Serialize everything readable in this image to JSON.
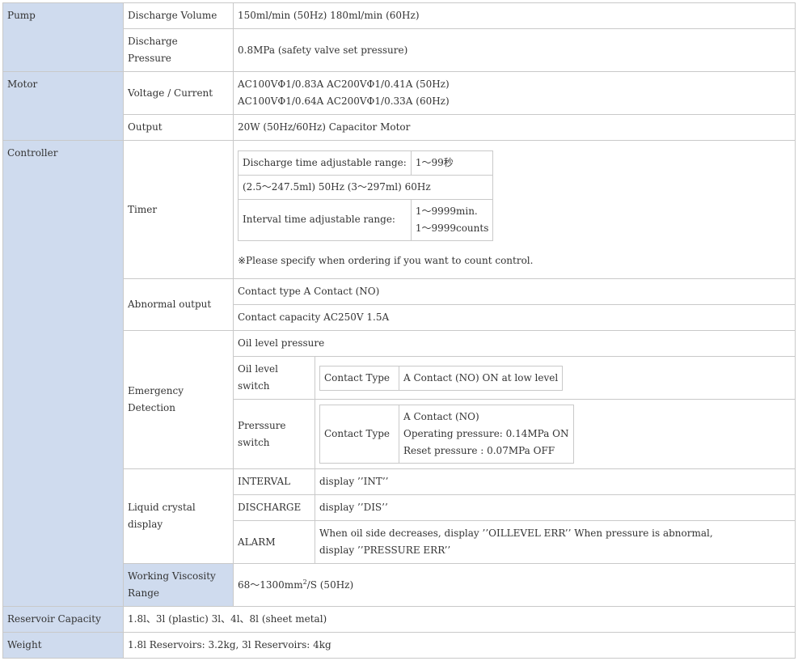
{
  "pump": {
    "heading": "Pump",
    "discharge_volume_label": "Discharge Volume",
    "discharge_volume_value": "150ml/min (50Hz)  180ml/min (60Hz)",
    "discharge_pressure_label": "Discharge\nPressure",
    "discharge_pressure_value": "0.8MPa (safety valve set pressure)"
  },
  "motor": {
    "heading": "Motor",
    "voltage_label": "Voltage / Current",
    "voltage_line1": "AC100VΦ1/0.83A  AC200VΦ1/0.41A (50Hz)",
    "voltage_line2": "AC100VΦ1/0.64A  AC200VΦ1/0.33A (60Hz)",
    "output_label": "Output",
    "output_value": "20W (50Hz/60Hz)  Capacitor Motor"
  },
  "controller": {
    "heading": "Controller",
    "timer_label": "Timer",
    "timer": {
      "discharge_time_label": "Discharge time adjustable range:",
      "discharge_time_value": "1〜99秒",
      "discharge_range_note": "(2.5〜247.5ml) 50Hz (3〜297ml) 60Hz",
      "interval_time_label": "Interval time adjustable range:",
      "interval_value_line1": "1〜9999min.",
      "interval_value_line2": "1〜9999counts",
      "count_note": "※Please specify when ordering if you want to count control."
    },
    "abnormal_output_label": "Abnormal output",
    "abnormal_contact_type": "Contact type A Contact (NO)",
    "abnormal_contact_capacity": "Contact capacity  AC250V  1.5A",
    "emergency_label": "Emergency\nDetection",
    "oil_level_pressure": "Oil level pressure",
    "oil_level_switch_label": "Oil level\nswitch",
    "oil_contact_type_label": "Contact Type",
    "oil_contact_type_value": "A Contact (NO) ON at low level",
    "pressure_switch_label": "Prerssure\nswitch",
    "pressure_contact_type_label": "Contact Type",
    "pressure_contact_line1": "A Contact (NO)",
    "pressure_contact_line2": "Operating pressure: 0.14MPa ON",
    "pressure_contact_line3": "Reset pressure : 0.07MPa OFF",
    "lcd_label": "Liquid crystal\ndisplay",
    "lcd_rows": [
      {
        "key": "INTERVAL",
        "value": "display ’’INT’’"
      },
      {
        "key": "DISCHARGE",
        "value": "display ’’DIS’’"
      },
      {
        "key": "ALARM",
        "value": "When oil side decreases, display ’’OILLEVEL ERR’’ When pressure is abnormal,\ndisplay ’’PRESSURE ERR’’"
      }
    ]
  },
  "viscosity": {
    "heading": "Working Viscosity\nRange",
    "value_prefix": "68〜1300mm",
    "value_sup": "2",
    "value_suffix": "/S (50Hz)"
  },
  "reservoir": {
    "heading": "Reservoir Capacity",
    "value": "1.8l、3l (plastic)  3l、4l、8l (sheet metal)"
  },
  "weight": {
    "heading": "Weight",
    "value": "1.8l Reservoirs: 3.2kg, 3l Reservoirs: 4kg"
  }
}
